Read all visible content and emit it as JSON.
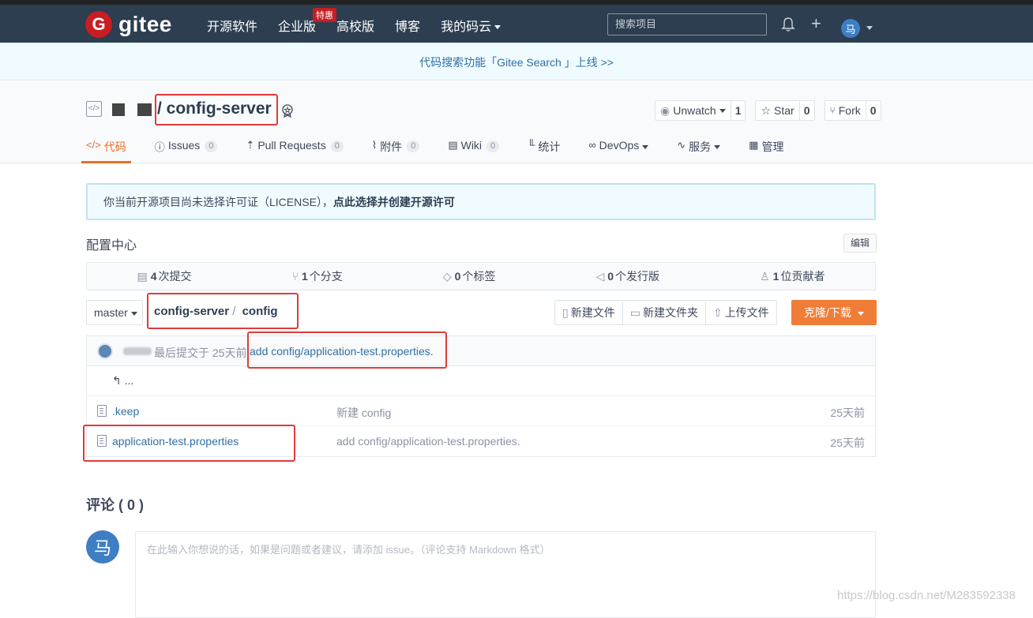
{
  "topbar": {
    "logo_letter": "G",
    "logo_text": "gitee",
    "nav": [
      {
        "label": "开源软件"
      },
      {
        "label": "企业版",
        "badge": "特惠"
      },
      {
        "label": "高校版"
      },
      {
        "label": "博客"
      },
      {
        "label": "我的码云"
      }
    ],
    "search_placeholder": "搜索项目",
    "avatar_letter": "马"
  },
  "announce": {
    "text": "代码搜索功能「Gitee Search 」上线 >>"
  },
  "repo": {
    "name": "/ config-server",
    "buttons": [
      {
        "label": "Unwatch",
        "count": "1",
        "icon": "eye-icon"
      },
      {
        "label": "Star",
        "count": "0",
        "icon": "star-icon"
      },
      {
        "label": "Fork",
        "count": "0",
        "icon": "fork-icon"
      }
    ],
    "tabs": [
      {
        "label": "代码",
        "icon": "code-icon",
        "active": true
      },
      {
        "label": "Issues",
        "badge": "0",
        "icon": "issue-icon"
      },
      {
        "label": "Pull Requests",
        "badge": "0",
        "icon": "pr-icon"
      },
      {
        "label": "附件",
        "badge": "0",
        "icon": "paperclip-icon"
      },
      {
        "label": "Wiki",
        "badge": "0",
        "icon": "book-icon"
      },
      {
        "label": "统计",
        "icon": "bar-chart-icon"
      },
      {
        "label": "DevOps",
        "icon": "infinity-icon"
      },
      {
        "label": "服务",
        "icon": "pulse-icon"
      },
      {
        "label": "管理",
        "icon": "settings-doc-icon"
      }
    ]
  },
  "license": {
    "text": "你当前开源项目尚未选择许可证（LICENSE），",
    "link": "点此选择并创建开源许可"
  },
  "description": "配置中心",
  "edit_label": "编辑",
  "stats": [
    {
      "count": "4",
      "label": "次提交",
      "icon": "commit-icon"
    },
    {
      "count": "1",
      "label": "个分支",
      "icon": "branch-icon"
    },
    {
      "count": "0",
      "label": "个标签",
      "icon": "tag-icon"
    },
    {
      "count": "0",
      "label": "个发行版",
      "icon": "release-icon"
    },
    {
      "count": "1",
      "label": "位贡献者",
      "icon": "contributors-icon"
    }
  ],
  "branch": "master",
  "breadcrumb": {
    "repo": "config-server",
    "sep": "/",
    "folder": "config"
  },
  "file_actions": [
    "新建文件",
    "新建文件夹",
    "上传文件"
  ],
  "clone_label": "克隆/下载",
  "last_commit": {
    "meta": "最后提交于 25天前",
    "message": "add config/application-test.properties."
  },
  "up_label": "...",
  "files": [
    {
      "name": ".keep",
      "message": "新建 config",
      "time": "25天前"
    },
    {
      "name": "application-test.properties",
      "message": "add config/application-test.properties.",
      "time": "25天前"
    }
  ],
  "comments": {
    "title": "评论 ( 0 )",
    "avatar_letter": "马",
    "placeholder": "在此输入你想说的话，如果是问题或者建议，请添加 issue。（评论支持 Markdown 格式）"
  },
  "watermark": "https://blog.csdn.net/M283592338"
}
